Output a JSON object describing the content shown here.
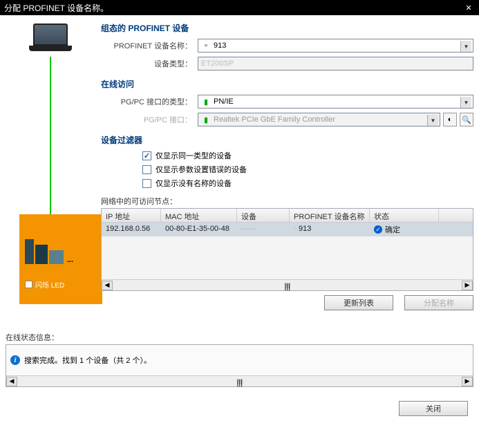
{
  "titlebar": {
    "title": "分配 PROFINET 设备名称。",
    "close": "✕"
  },
  "sections": {
    "configured": {
      "title": "组态的 PROFINET 设备",
      "device_name_label": "PROFINET 设备名称：",
      "device_name_value": "913",
      "device_type_label": "设备类型：",
      "device_type_value": "ET200SP"
    },
    "online": {
      "title": "在线访问",
      "pgpc_type_label": "PG/PC 接口的类型：",
      "pgpc_type_value": "PN/IE",
      "pgpc_iface_label": "PG/PC 接口：",
      "pgpc_iface_value": "Realtek PCIe GbE Family Controller"
    },
    "filter": {
      "title": "设备过滤器",
      "opt1": "仅显示同一类型的设备",
      "opt2": "仅显示参数设置错误的设备",
      "opt3": "仅显示没有名称的设备"
    }
  },
  "table": {
    "caption": "网络中的可访问节点：",
    "columns": {
      "ip": "IP 地址",
      "mac": "MAC 地址",
      "dev": "设备",
      "pn": "PROFINET 设备名称",
      "status": "状态"
    },
    "rows": [
      {
        "ip": "192.168.0.56",
        "mac": "00-80-E1-35-00-48",
        "dev": "——",
        "pn": "913",
        "status": "确定"
      }
    ]
  },
  "buttons": {
    "refresh": "更新列表",
    "assign": "分配名称",
    "close": "关闭"
  },
  "flash_led": "闪烁 LED",
  "status": {
    "label": "在线状态信息：",
    "message": "搜索完成。找到 1 个设备（共 2 个）。"
  }
}
